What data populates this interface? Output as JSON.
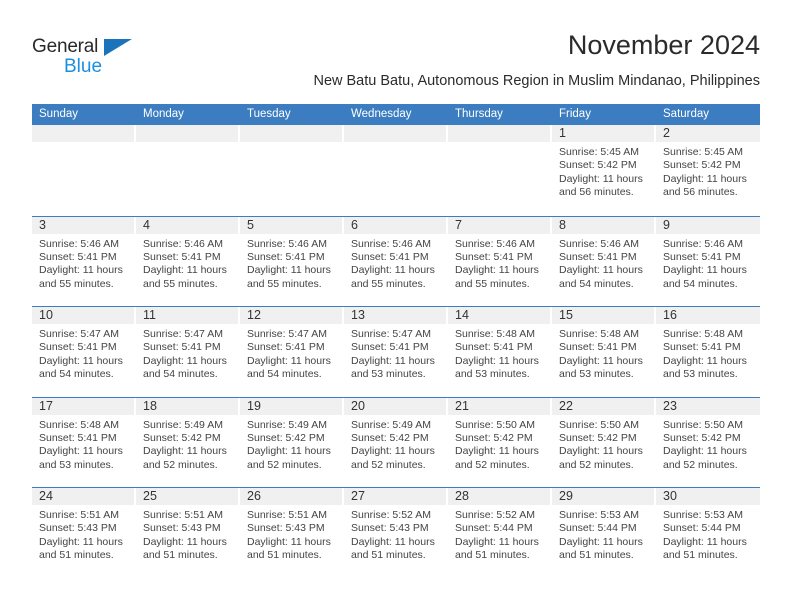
{
  "branding": {
    "logo_text_primary": "General",
    "logo_text_secondary": "Blue",
    "logo_icon": "triangle-icon",
    "accent_color": "#1b74bb",
    "secondary_color": "#1b8fe0"
  },
  "header": {
    "title": "November 2024",
    "subtitle": "New Batu Batu, Autonomous Region in Muslim Mindanao, Philippines"
  },
  "theme": {
    "header_row_color": "#3b7dc0",
    "day_band_color": "#f0f0f0",
    "row_divider_color": "#3b7dc0",
    "text_color": "#444444"
  },
  "calendar": {
    "weekdays": [
      "Sunday",
      "Monday",
      "Tuesday",
      "Wednesday",
      "Thursday",
      "Friday",
      "Saturday"
    ],
    "weeks": [
      [
        {
          "day": "",
          "lines": []
        },
        {
          "day": "",
          "lines": []
        },
        {
          "day": "",
          "lines": []
        },
        {
          "day": "",
          "lines": []
        },
        {
          "day": "",
          "lines": []
        },
        {
          "day": "1",
          "lines": [
            "Sunrise: 5:45 AM",
            "Sunset: 5:42 PM",
            "Daylight: 11 hours",
            "and 56 minutes."
          ]
        },
        {
          "day": "2",
          "lines": [
            "Sunrise: 5:45 AM",
            "Sunset: 5:42 PM",
            "Daylight: 11 hours",
            "and 56 minutes."
          ]
        }
      ],
      [
        {
          "day": "3",
          "lines": [
            "Sunrise: 5:46 AM",
            "Sunset: 5:41 PM",
            "Daylight: 11 hours",
            "and 55 minutes."
          ]
        },
        {
          "day": "4",
          "lines": [
            "Sunrise: 5:46 AM",
            "Sunset: 5:41 PM",
            "Daylight: 11 hours",
            "and 55 minutes."
          ]
        },
        {
          "day": "5",
          "lines": [
            "Sunrise: 5:46 AM",
            "Sunset: 5:41 PM",
            "Daylight: 11 hours",
            "and 55 minutes."
          ]
        },
        {
          "day": "6",
          "lines": [
            "Sunrise: 5:46 AM",
            "Sunset: 5:41 PM",
            "Daylight: 11 hours",
            "and 55 minutes."
          ]
        },
        {
          "day": "7",
          "lines": [
            "Sunrise: 5:46 AM",
            "Sunset: 5:41 PM",
            "Daylight: 11 hours",
            "and 55 minutes."
          ]
        },
        {
          "day": "8",
          "lines": [
            "Sunrise: 5:46 AM",
            "Sunset: 5:41 PM",
            "Daylight: 11 hours",
            "and 54 minutes."
          ]
        },
        {
          "day": "9",
          "lines": [
            "Sunrise: 5:46 AM",
            "Sunset: 5:41 PM",
            "Daylight: 11 hours",
            "and 54 minutes."
          ]
        }
      ],
      [
        {
          "day": "10",
          "lines": [
            "Sunrise: 5:47 AM",
            "Sunset: 5:41 PM",
            "Daylight: 11 hours",
            "and 54 minutes."
          ]
        },
        {
          "day": "11",
          "lines": [
            "Sunrise: 5:47 AM",
            "Sunset: 5:41 PM",
            "Daylight: 11 hours",
            "and 54 minutes."
          ]
        },
        {
          "day": "12",
          "lines": [
            "Sunrise: 5:47 AM",
            "Sunset: 5:41 PM",
            "Daylight: 11 hours",
            "and 54 minutes."
          ]
        },
        {
          "day": "13",
          "lines": [
            "Sunrise: 5:47 AM",
            "Sunset: 5:41 PM",
            "Daylight: 11 hours",
            "and 53 minutes."
          ]
        },
        {
          "day": "14",
          "lines": [
            "Sunrise: 5:48 AM",
            "Sunset: 5:41 PM",
            "Daylight: 11 hours",
            "and 53 minutes."
          ]
        },
        {
          "day": "15",
          "lines": [
            "Sunrise: 5:48 AM",
            "Sunset: 5:41 PM",
            "Daylight: 11 hours",
            "and 53 minutes."
          ]
        },
        {
          "day": "16",
          "lines": [
            "Sunrise: 5:48 AM",
            "Sunset: 5:41 PM",
            "Daylight: 11 hours",
            "and 53 minutes."
          ]
        }
      ],
      [
        {
          "day": "17",
          "lines": [
            "Sunrise: 5:48 AM",
            "Sunset: 5:41 PM",
            "Daylight: 11 hours",
            "and 53 minutes."
          ]
        },
        {
          "day": "18",
          "lines": [
            "Sunrise: 5:49 AM",
            "Sunset: 5:42 PM",
            "Daylight: 11 hours",
            "and 52 minutes."
          ]
        },
        {
          "day": "19",
          "lines": [
            "Sunrise: 5:49 AM",
            "Sunset: 5:42 PM",
            "Daylight: 11 hours",
            "and 52 minutes."
          ]
        },
        {
          "day": "20",
          "lines": [
            "Sunrise: 5:49 AM",
            "Sunset: 5:42 PM",
            "Daylight: 11 hours",
            "and 52 minutes."
          ]
        },
        {
          "day": "21",
          "lines": [
            "Sunrise: 5:50 AM",
            "Sunset: 5:42 PM",
            "Daylight: 11 hours",
            "and 52 minutes."
          ]
        },
        {
          "day": "22",
          "lines": [
            "Sunrise: 5:50 AM",
            "Sunset: 5:42 PM",
            "Daylight: 11 hours",
            "and 52 minutes."
          ]
        },
        {
          "day": "23",
          "lines": [
            "Sunrise: 5:50 AM",
            "Sunset: 5:42 PM",
            "Daylight: 11 hours",
            "and 52 minutes."
          ]
        }
      ],
      [
        {
          "day": "24",
          "lines": [
            "Sunrise: 5:51 AM",
            "Sunset: 5:43 PM",
            "Daylight: 11 hours",
            "and 51 minutes."
          ]
        },
        {
          "day": "25",
          "lines": [
            "Sunrise: 5:51 AM",
            "Sunset: 5:43 PM",
            "Daylight: 11 hours",
            "and 51 minutes."
          ]
        },
        {
          "day": "26",
          "lines": [
            "Sunrise: 5:51 AM",
            "Sunset: 5:43 PM",
            "Daylight: 11 hours",
            "and 51 minutes."
          ]
        },
        {
          "day": "27",
          "lines": [
            "Sunrise: 5:52 AM",
            "Sunset: 5:43 PM",
            "Daylight: 11 hours",
            "and 51 minutes."
          ]
        },
        {
          "day": "28",
          "lines": [
            "Sunrise: 5:52 AM",
            "Sunset: 5:44 PM",
            "Daylight: 11 hours",
            "and 51 minutes."
          ]
        },
        {
          "day": "29",
          "lines": [
            "Sunrise: 5:53 AM",
            "Sunset: 5:44 PM",
            "Daylight: 11 hours",
            "and 51 minutes."
          ]
        },
        {
          "day": "30",
          "lines": [
            "Sunrise: 5:53 AM",
            "Sunset: 5:44 PM",
            "Daylight: 11 hours",
            "and 51 minutes."
          ]
        }
      ]
    ]
  }
}
